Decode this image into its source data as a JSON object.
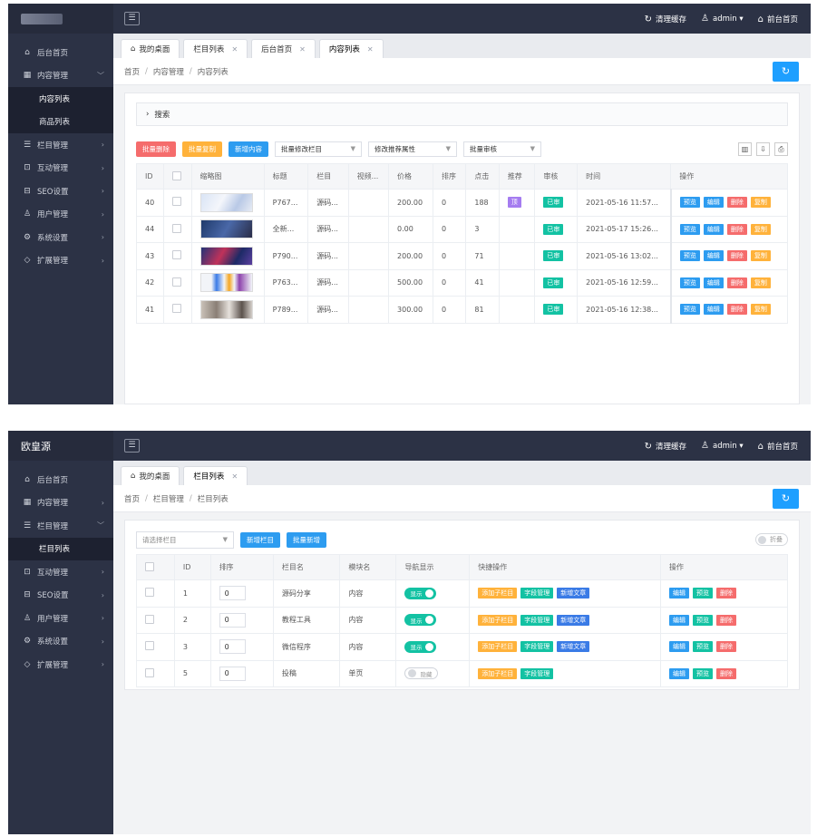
{
  "panel1": {
    "top": {
      "clear_cache": "清理缓存",
      "admin": "admin",
      "front_home": "前台首页"
    },
    "menu": [
      {
        "icon": "home-icon",
        "glyph": "⌂",
        "label": "后台首页",
        "arrow": ""
      },
      {
        "icon": "content-icon",
        "glyph": "▦",
        "label": "内容管理",
        "arrow": "﹀"
      },
      {
        "icon": "",
        "glyph": "",
        "label": "内容列表",
        "sub": true
      },
      {
        "icon": "",
        "glyph": "",
        "label": "商品列表",
        "sub": true
      },
      {
        "icon": "list-icon",
        "glyph": "☰",
        "label": "栏目管理",
        "arrow": "›"
      },
      {
        "icon": "interact-icon",
        "glyph": "⊡",
        "label": "互动管理",
        "arrow": "›"
      },
      {
        "icon": "seo-icon",
        "glyph": "⊟",
        "label": "SEO设置",
        "arrow": "›"
      },
      {
        "icon": "user-icon",
        "glyph": "♙",
        "label": "用户管理",
        "arrow": "›"
      },
      {
        "icon": "gear-icon",
        "glyph": "⚙",
        "label": "系统设置",
        "arrow": "›"
      },
      {
        "icon": "extend-icon",
        "glyph": "◇",
        "label": "扩展管理",
        "arrow": "›"
      }
    ],
    "tabs": [
      {
        "label": "我的桌面",
        "closable": false,
        "home": true
      },
      {
        "label": "栏目列表",
        "closable": true
      },
      {
        "label": "后台首页",
        "closable": true
      },
      {
        "label": "内容列表",
        "closable": true
      }
    ],
    "breadcrumb": [
      "首页",
      "内容管理",
      "内容列表"
    ],
    "search_label": "搜索",
    "toolbar": {
      "batch_delete": "批量删除",
      "batch_copy": "批量复制",
      "add_content": "新增内容",
      "sel_column": "批量修改栏目",
      "sel_recommend": "修改推荐属性",
      "sel_audit": "批量审核"
    },
    "columns": [
      "ID",
      "",
      "缩略图",
      "标题",
      "栏目",
      "视频...",
      "价格",
      "排序",
      "点击",
      "推荐",
      "审核",
      "时间",
      "操作"
    ],
    "rows": [
      {
        "id": "40",
        "thumb": "t1",
        "title": "P767...",
        "col": "源码...",
        "price": "200.00",
        "sort": "0",
        "clicks": "188",
        "rec": "顶",
        "audit": "已审",
        "time": "2021-05-16 11:57..."
      },
      {
        "id": "44",
        "thumb": "t2",
        "title": "全新...",
        "col": "源码...",
        "price": "0.00",
        "sort": "0",
        "clicks": "3",
        "rec": "",
        "audit": "已审",
        "time": "2021-05-17 15:26..."
      },
      {
        "id": "43",
        "thumb": "t3",
        "title": "P790...",
        "col": "源码...",
        "price": "200.00",
        "sort": "0",
        "clicks": "71",
        "rec": "",
        "audit": "已审",
        "time": "2021-05-16 13:02..."
      },
      {
        "id": "42",
        "thumb": "t4",
        "title": "P763...",
        "col": "源码...",
        "price": "500.00",
        "sort": "0",
        "clicks": "41",
        "rec": "",
        "audit": "已审",
        "time": "2021-05-16 12:59..."
      },
      {
        "id": "41",
        "thumb": "t5",
        "title": "P789...",
        "col": "源码...",
        "price": "300.00",
        "sort": "0",
        "clicks": "81",
        "rec": "",
        "audit": "已审",
        "time": "2021-05-16 12:38..."
      }
    ],
    "row_ops": [
      "预览",
      "编辑",
      "删除",
      "复制"
    ]
  },
  "panel2": {
    "logo": "欧皇源",
    "top": {
      "clear_cache": "清理缓存",
      "admin": "admin",
      "front_home": "前台首页"
    },
    "menu": [
      {
        "icon": "home-icon",
        "glyph": "⌂",
        "label": "后台首页",
        "arrow": ""
      },
      {
        "icon": "content-icon",
        "glyph": "▦",
        "label": "内容管理",
        "arrow": "›"
      },
      {
        "icon": "list-icon",
        "glyph": "☰",
        "label": "栏目管理",
        "arrow": "﹀"
      },
      {
        "icon": "",
        "glyph": "",
        "label": "栏目列表",
        "sub": true
      },
      {
        "icon": "interact-icon",
        "glyph": "⊡",
        "label": "互动管理",
        "arrow": "›"
      },
      {
        "icon": "seo-icon",
        "glyph": "⊟",
        "label": "SEO设置",
        "arrow": "›"
      },
      {
        "icon": "user-icon",
        "glyph": "♙",
        "label": "用户管理",
        "arrow": "›"
      },
      {
        "icon": "gear-icon",
        "glyph": "⚙",
        "label": "系统设置",
        "arrow": "›"
      },
      {
        "icon": "extend-icon",
        "glyph": "◇",
        "label": "扩展管理",
        "arrow": "›"
      }
    ],
    "tabs": [
      {
        "label": "我的桌面",
        "closable": false,
        "home": true
      },
      {
        "label": "栏目列表",
        "closable": true
      }
    ],
    "breadcrumb": [
      "首页",
      "栏目管理",
      "栏目列表"
    ],
    "toolbar": {
      "select_placeholder": "请选择栏目",
      "add_column": "新增栏目",
      "batch_add": "批量新增",
      "fold": "折叠"
    },
    "columns": [
      "",
      "ID",
      "排序",
      "栏目名",
      "模块名",
      "导航显示",
      "快捷操作",
      "操作"
    ],
    "rows": [
      {
        "id": "1",
        "sort": "0",
        "name": "源码分享",
        "module": "内容",
        "nav": "显示",
        "nav_on": true,
        "quick": [
          "添加子栏目",
          "字段管理",
          "新增文章"
        ]
      },
      {
        "id": "2",
        "sort": "0",
        "name": "教程工具",
        "module": "内容",
        "nav": "显示",
        "nav_on": true,
        "quick": [
          "添加子栏目",
          "字段管理",
          "新增文章"
        ]
      },
      {
        "id": "3",
        "sort": "0",
        "name": "微信程序",
        "module": "内容",
        "nav": "显示",
        "nav_on": true,
        "quick": [
          "添加子栏目",
          "字段管理",
          "新增文章"
        ]
      },
      {
        "id": "5",
        "sort": "0",
        "name": "投稿",
        "module": "单页",
        "nav": "隐藏",
        "nav_on": false,
        "quick": [
          "添加子栏目",
          "字段管理"
        ]
      }
    ],
    "row_ops": [
      "编辑",
      "预览",
      "删除"
    ]
  }
}
